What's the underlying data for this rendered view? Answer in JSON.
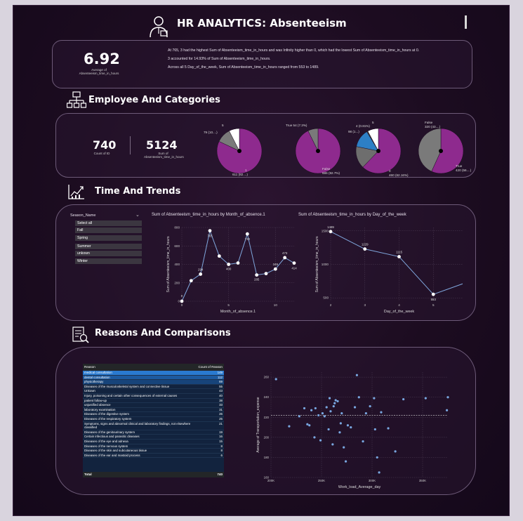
{
  "header": {
    "title": "HR ANALYTICS: Absenteeism"
  },
  "summary": {
    "kpi_value": "6.92",
    "kpi_label": "Average of Absenteeism_time_in_hours",
    "narrative": [
      "At 765, 3 had the highest Sum of Absenteeism_time_in_hours and was Infinity higher than 0, which had the lowest Sum of Absenteeism_time_in_hours at 0.",
      "3 accounted for 14.93% of Sum of Absenteeism_time_in_hours.",
      "Across all 5 Day_of_the_week, Sum of Absenteeism_time_in_hours ranged from 553 to 1489."
    ]
  },
  "sections": {
    "employee": "Employee And Categories",
    "time": "Time And Trends",
    "reasons": "Reasons And Comparisons"
  },
  "employee_kpis": {
    "count_value": "740",
    "count_label": "Count of ID",
    "sum_value": "5124",
    "sum_label": "Sum of Absenteeism_time_in_hours"
  },
  "pies": [
    {
      "slices": [
        {
          "label": "1 611 (82....)",
          "value": 82,
          "color": "#8e2a8e"
        },
        {
          "label": "79 (10....)",
          "value": 10.5,
          "color": "#7a7a7a"
        },
        {
          "label": "5",
          "value": 7.5,
          "color": "#ffffff"
        }
      ]
    },
    {
      "slices": [
        {
          "label": "False 686 (92.7%)",
          "value": 92.7,
          "color": "#8e2a8e"
        },
        {
          "label": "True 54 (7.3%)",
          "value": 7.3,
          "color": "#7a7a7a"
        }
      ]
    },
    {
      "slices": [
        {
          "label": "0 460 (62.16%)",
          "value": 62.16,
          "color": "#8e2a8e"
        },
        {
          "label": "",
          "value": 16,
          "color": "#6e6e6e"
        },
        {
          "label": "98 (1...)",
          "value": 13.2,
          "color": "#2d7fc6"
        },
        {
          "label": "4 (0.81%)",
          "value": 0.81,
          "color": "#3b3b3b"
        },
        {
          "label": "5",
          "value": 7.8,
          "color": "#ffffff"
        }
      ]
    },
    {
      "slices": [
        {
          "label": "True 420 (56....)",
          "value": 56.8,
          "color": "#8e2a8e"
        },
        {
          "label": "False 320 (43....)",
          "value": 43.2,
          "color": "#7a7a7a"
        }
      ]
    }
  ],
  "slicer": {
    "title": "Season_Name",
    "items": [
      "Select all",
      "Fall",
      "Spring",
      "Summer",
      "unkown",
      "Winter"
    ]
  },
  "chart_data": [
    {
      "type": "line",
      "title": "Sum of Absenteeism_time_in_hours by Month_of_absence.1",
      "xlabel": "Month_of_absence.1",
      "ylabel": "Sum of Absenteeism_time_in_hours",
      "x": [
        0,
        1,
        2,
        3,
        4,
        5,
        6,
        7,
        8,
        9,
        10,
        11,
        12
      ],
      "values": [
        0,
        223,
        294,
        765,
        490,
        400,
        415,
        730,
        285,
        300,
        349,
        473,
        414
      ],
      "data_labels": [
        "0",
        "",
        "294",
        "765",
        "",
        "400",
        "",
        "730",
        "285",
        "",
        "349",
        "473",
        "414"
      ],
      "xticks": [
        "0",
        "5",
        "10"
      ],
      "yticks": [
        "0",
        "200",
        "400",
        "600",
        "800"
      ],
      "ylim": [
        0,
        800
      ]
    },
    {
      "type": "line",
      "title": "Sum of Absenteeism_time_in_hours by Day_of_the_week",
      "xlabel": "Day_of_the_week",
      "ylabel": "Sum of Absenteeism_time_in_hours",
      "x": [
        2,
        3,
        4,
        5,
        6
      ],
      "values": [
        1489,
        1229,
        1115,
        553,
        736
      ],
      "data_labels": [
        "1489",
        "1229",
        "1115",
        "553",
        "736"
      ],
      "xticks": [
        "2",
        "3",
        "4",
        "5",
        "6"
      ],
      "yticks": [
        "500",
        "1000",
        "1500"
      ],
      "ylim": [
        450,
        1550
      ]
    },
    {
      "type": "scatter",
      "xlabel": "Work_load_Average_day",
      "ylabel": "Average of Transportation_expense",
      "xticks": [
        "200K",
        "250K",
        "300K",
        "350K"
      ],
      "yticks": [
        "160",
        "180",
        "200",
        "220",
        "240",
        "260"
      ],
      "xlim": [
        200000,
        375000
      ],
      "ylim": [
        160,
        265
      ],
      "trend": 222,
      "points": [
        [
          205000,
          258
        ],
        [
          218000,
          211
        ],
        [
          228000,
          221
        ],
        [
          233000,
          229
        ],
        [
          236000,
          213
        ],
        [
          238000,
          212
        ],
        [
          240000,
          227
        ],
        [
          243000,
          200
        ],
        [
          244000,
          229
        ],
        [
          247000,
          222
        ],
        [
          249000,
          197
        ],
        [
          251000,
          224
        ],
        [
          253000,
          221
        ],
        [
          255000,
          230
        ],
        [
          257000,
          208
        ],
        [
          258000,
          239
        ],
        [
          259000,
          226
        ],
        [
          261000,
          193
        ],
        [
          262000,
          231
        ],
        [
          263000,
          234
        ],
        [
          264000,
          237
        ],
        [
          266000,
          236
        ],
        [
          268000,
          205
        ],
        [
          269000,
          214
        ],
        [
          270000,
          224
        ],
        [
          272000,
          190
        ],
        [
          274000,
          176
        ],
        [
          276000,
          212
        ],
        [
          279000,
          210
        ],
        [
          283000,
          230
        ],
        [
          285000,
          262
        ],
        [
          287000,
          240
        ],
        [
          291000,
          196
        ],
        [
          294000,
          224
        ],
        [
          298000,
          231
        ],
        [
          302000,
          239
        ],
        [
          303000,
          208
        ],
        [
          305000,
          180
        ],
        [
          307000,
          165
        ],
        [
          309000,
          225
        ],
        [
          316000,
          209
        ],
        [
          323000,
          186
        ],
        [
          331000,
          238
        ],
        [
          353000,
          239
        ],
        [
          374000,
          227
        ],
        [
          375000,
          240
        ]
      ]
    }
  ],
  "reasons_table": {
    "headers": [
      "Reason",
      "Count of Reason"
    ],
    "rows": [
      [
        "medical consultation",
        "149"
      ],
      [
        "dental consultation",
        "112"
      ],
      [
        "physiotherapy",
        "69"
      ],
      [
        "Diseases of the musculoskeletal system and connective tissue",
        "55"
      ],
      [
        "Unkown",
        "43"
      ],
      [
        "Injury, poisoning and certain other consequences of external causes",
        "40"
      ],
      [
        "patient follow-up",
        "38"
      ],
      [
        "unjustified absence",
        "33"
      ],
      [
        "laboratory examination",
        "31"
      ],
      [
        "Diseases of the digestive system",
        "26"
      ],
      [
        "Diseases of the respiratory system",
        "25"
      ],
      [
        "Symptoms, signs and abnormal clinical and laboratory findings, not elsewhere classified",
        "21"
      ],
      [
        "Diseases of the genitourinary system",
        "19"
      ],
      [
        "Certain infectious and parasitic diseases",
        "16"
      ],
      [
        "Diseases of the eye and adnexa",
        "15"
      ],
      [
        "Diseases of the nervous system",
        "8"
      ],
      [
        "Diseases of the skin and subcutaneous tissue",
        "8"
      ],
      [
        "Diseases of the ear and mastoid process",
        "6"
      ]
    ],
    "total_label": "Total",
    "total_value": "740"
  }
}
